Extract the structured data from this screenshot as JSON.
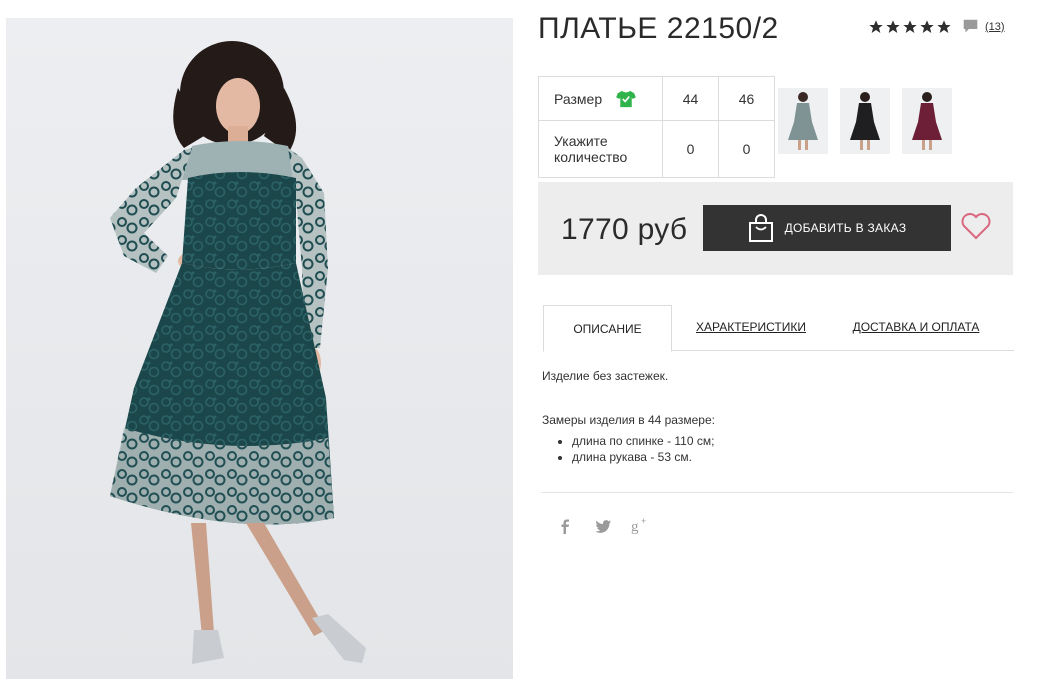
{
  "product": {
    "title": "ПЛАТЬЕ 22150/2",
    "rating_stars": 5,
    "reviews_link": "(13)"
  },
  "size_table": {
    "size_label": "Размер",
    "sizes": [
      "44",
      "46"
    ],
    "qty_label_line1": "Укажите",
    "qty_label_line2": "количество",
    "quantities": [
      "0",
      "0"
    ]
  },
  "thumbnails": [
    {
      "color_name": "teal",
      "color": "#7f9294"
    },
    {
      "color_name": "black",
      "color": "#1f1f22"
    },
    {
      "color_name": "burgundy",
      "color": "#6c1f36"
    }
  ],
  "purchase": {
    "price": "1770 руб",
    "add_button": "ДОБАВИТЬ В ЗАКАЗ"
  },
  "tabs": [
    {
      "label": "ОПИСАНИЕ",
      "active": true
    },
    {
      "label": "ХАРАКТЕРИСТИКИ",
      "active": false
    },
    {
      "label": "ДОСТАВКА И ОПЛАТА",
      "active": false
    }
  ],
  "description": {
    "line1": "Изделие без застежек.",
    "measure_title": "Замеры изделия в 44 размере:",
    "measures": [
      "длина по спинке - 110 см;",
      "длина рукава - 53 см."
    ]
  },
  "social": [
    "facebook-icon",
    "twitter-icon",
    "google-plus-icon"
  ],
  "colors": {
    "button_bg": "#333333",
    "panel_bg": "#ededed",
    "heart": "#d9677f",
    "tshirt": "#2fb34a",
    "dress": "#173f43"
  }
}
